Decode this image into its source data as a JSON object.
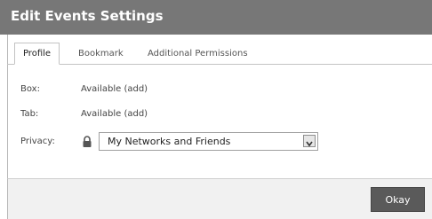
{
  "dialog": {
    "title": "Edit Events Settings",
    "tabs": [
      "Profile",
      "Bookmark",
      "Additional Permissions"
    ],
    "active_tab": "Profile",
    "rows": {
      "box": {
        "label": "Box:",
        "value": "Available (add)"
      },
      "tab": {
        "label": "Tab:",
        "value": "Available (add)"
      },
      "privacy": {
        "label": "Privacy:",
        "selected": "My Networks and Friends"
      }
    },
    "okay_label": "Okay"
  },
  "colors": {
    "titlebar": "#777777",
    "button": "#5a5a5a",
    "footer": "#f1f1f1"
  },
  "icons": {
    "privacy_icon": "lock-icon",
    "dropdown_icon": "chevron-down-icon"
  }
}
